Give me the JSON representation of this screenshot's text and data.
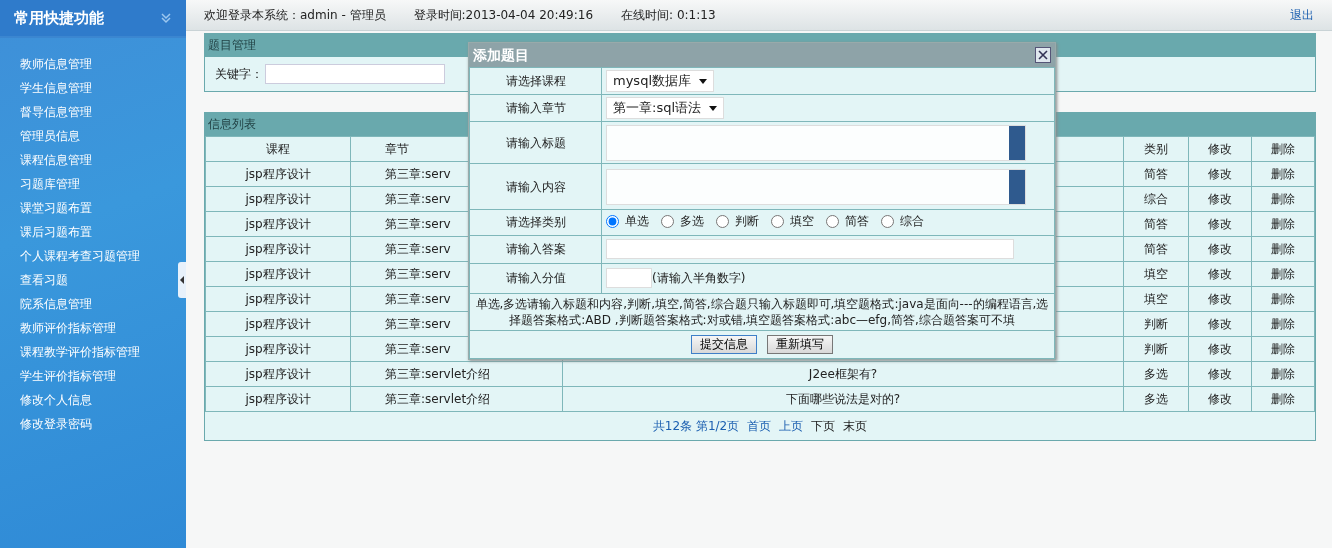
{
  "sidebar": {
    "title": "常用快捷功能",
    "items": [
      {
        "label": "教师信息管理"
      },
      {
        "label": "学生信息管理"
      },
      {
        "label": "督导信息管理"
      },
      {
        "label": "管理员信息"
      },
      {
        "label": "课程信息管理"
      },
      {
        "label": "习题库管理"
      },
      {
        "label": "课堂习题布置"
      },
      {
        "label": "课后习题布置"
      },
      {
        "label": "个人课程考查习题管理"
      },
      {
        "label": "查看习题"
      },
      {
        "label": "院系信息管理"
      },
      {
        "label": "教师评价指标管理"
      },
      {
        "label": "课程教学评价指标管理"
      },
      {
        "label": "学生评价指标管理"
      },
      {
        "label": "修改个人信息"
      },
      {
        "label": "修改登录密码"
      }
    ]
  },
  "top_bar": {
    "welcome": "欢迎登录本系统：admin - 管理员",
    "login_time": "登录时间:2013-04-04 20:49:16",
    "online_time": "在线时间: 0:1:13",
    "logout": "退出"
  },
  "search_panel": {
    "title": "题目管理",
    "keyword_label": "关键字："
  },
  "list_panel": {
    "title": "信息列表",
    "columns": [
      "课程",
      "章节",
      "类别",
      "修改",
      "删除"
    ],
    "rows": [
      {
        "course": "jsp程序设计",
        "chapter": "第三章:serv",
        "type": "简答",
        "edit": "修改",
        "delete": "删除"
      },
      {
        "course": "jsp程序设计",
        "chapter": "第三章:serv",
        "type": "综合",
        "edit": "修改",
        "delete": "删除"
      },
      {
        "course": "jsp程序设计",
        "chapter": "第三章:serv",
        "type": "简答",
        "edit": "修改",
        "delete": "删除"
      },
      {
        "course": "jsp程序设计",
        "chapter": "第三章:serv",
        "type": "简答",
        "edit": "修改",
        "delete": "删除"
      },
      {
        "course": "jsp程序设计",
        "chapter": "第三章:serv",
        "type": "填空",
        "edit": "修改",
        "delete": "删除"
      },
      {
        "course": "jsp程序设计",
        "chapter": "第三章:serv",
        "type": "填空",
        "edit": "修改",
        "delete": "删除"
      },
      {
        "course": "jsp程序设计",
        "chapter": "第三章:serv",
        "type": "判断",
        "edit": "修改",
        "delete": "删除"
      },
      {
        "course": "jsp程序设计",
        "chapter": "第三章:serv",
        "type": "判断",
        "edit": "修改",
        "delete": "删除"
      },
      {
        "course": "jsp程序设计",
        "chapter": "第三章:servlet介绍",
        "title": "J2ee框架有?",
        "type": "多选",
        "edit": "修改",
        "delete": "删除"
      },
      {
        "course": "jsp程序设计",
        "chapter": "第三章:servlet介绍",
        "title": "下面哪些说法是对的?",
        "type": "多选",
        "edit": "修改",
        "delete": "删除"
      }
    ],
    "pager": {
      "summary": "共12条 第1/2页",
      "links": [
        {
          "label": "首页",
          "disabled": false
        },
        {
          "label": "上页",
          "disabled": false
        },
        {
          "label": "下页",
          "disabled": true
        },
        {
          "label": "末页",
          "disabled": true
        }
      ]
    }
  },
  "dialog": {
    "title": "添加题目",
    "fields": [
      {
        "kind": "select",
        "label": "请选择课程",
        "value": "mysql数据库"
      },
      {
        "kind": "select",
        "label": "请输入章节",
        "value": "第一章:sql语法"
      },
      {
        "kind": "textarea",
        "label": "请输入标题"
      },
      {
        "kind": "textarea",
        "label": "请输入内容"
      },
      {
        "kind": "radios",
        "label": "请选择类别",
        "options": [
          {
            "label": "单选",
            "selected": true
          },
          {
            "label": "多选",
            "selected": false
          },
          {
            "label": "判断",
            "selected": false
          },
          {
            "label": "填空",
            "selected": false
          },
          {
            "label": "简答",
            "selected": false
          },
          {
            "label": "综合",
            "selected": false
          }
        ]
      },
      {
        "kind": "text",
        "label": "请输入答案"
      },
      {
        "kind": "score",
        "label": "请输入分值",
        "hint": "(请输入半角数字)"
      }
    ],
    "note": "单选,多选请输入标题和内容,判断,填空,简答,综合题只输入标题即可,填空题格式:java是面向---的编程语言,选择题答案格式:ABD ,判断题答案格式:对或错,填空题答案格式:abc—efg,简答,综合题答案可不填",
    "buttons": [
      "提交信息",
      "重新填写"
    ]
  }
}
